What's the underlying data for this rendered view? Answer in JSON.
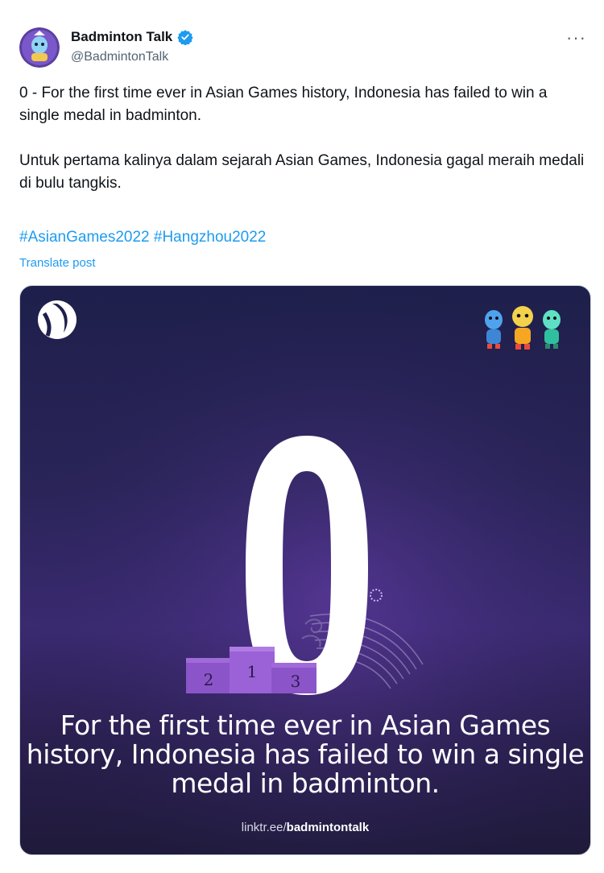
{
  "author": {
    "name": "Badminton Talk",
    "handle": "@BadmintonTalk",
    "verified": true
  },
  "tweet": {
    "paragraph1": "0 - For the first time ever in Asian Games history, Indonesia has failed to win a single medal in badminton.",
    "paragraph2": "Untuk pertama kalinya dalam sejarah Asian Games, Indonesia gagal meraih medali di bulu tangkis.",
    "hashtags": [
      "#AsianGames2022",
      "#Hangzhou2022"
    ]
  },
  "translate_label": "Translate post",
  "more_label": "···",
  "media": {
    "big_number": "0",
    "podium": [
      "2",
      "1",
      "3"
    ],
    "caption_lines": [
      "For the first time ever in Asian Games",
      "history, Indonesia has failed to win a single",
      "medal in badminton."
    ],
    "link_prefix": "linktr.ee/",
    "link_suffix": "badmintontalk"
  },
  "colors": {
    "link_blue": "#1d9bf0",
    "muted": "#536471",
    "podium": "#8b55c9"
  }
}
